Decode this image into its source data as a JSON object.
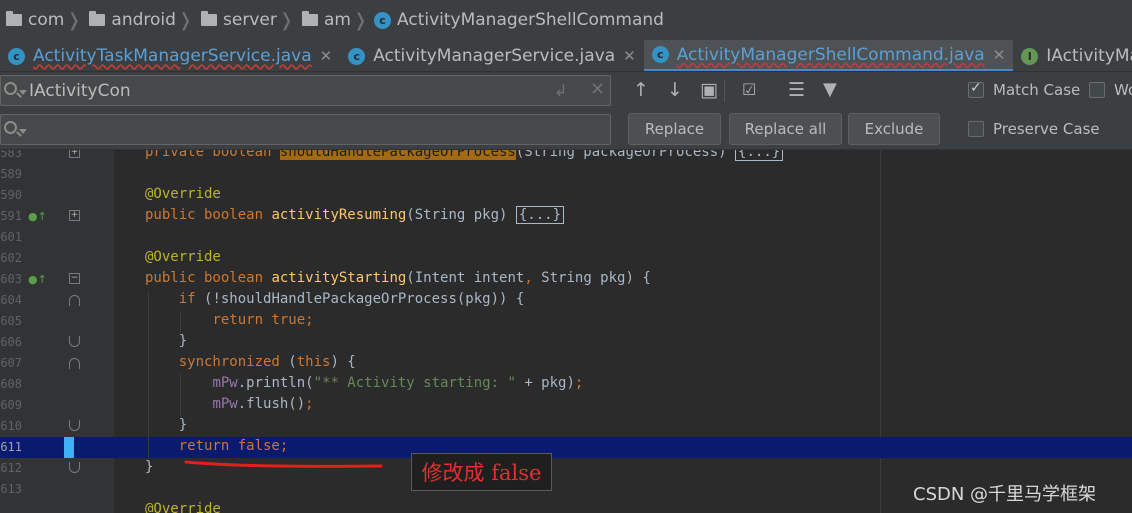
{
  "breadcrumb": {
    "items": [
      "com",
      "android",
      "server",
      "am",
      "ActivityManagerShellCommand"
    ]
  },
  "tabs": [
    {
      "label": "ActivityTaskManagerService.java",
      "icon": "class-icon",
      "has_error": true,
      "active": false
    },
    {
      "label": "ActivityManagerService.java",
      "icon": "class-icon",
      "has_error": false,
      "active": false
    },
    {
      "label": "ActivityManagerShellCommand.java",
      "icon": "class-icon",
      "has_error": true,
      "active": true
    },
    {
      "label": "IActivityManager",
      "icon": "interface-icon",
      "has_error": false,
      "active": false
    }
  ],
  "find": {
    "value": "IActivityCon",
    "replace_value": "",
    "replace_label": "Replace",
    "replace_all_label": "Replace all",
    "exclude_label": "Exclude",
    "match_case_label": "Match Case",
    "words_label": "Wo",
    "preserve_case_label": "Preserve Case",
    "match_case_checked": true,
    "words_checked": false,
    "preserve_case_checked": false
  },
  "editor": {
    "line_numbers": [
      "583",
      "589",
      "590",
      "591",
      "601",
      "602",
      "603",
      "604",
      "605",
      "606",
      "607",
      "608",
      "609",
      "610",
      "611",
      "612",
      "613"
    ],
    "highlighted_line": "611"
  },
  "annotation": {
    "text": "修改成 false",
    "color": "#e0312d"
  },
  "watermark": "CSDN @千里马学框架",
  "colors": {
    "keyword": "#cc7832",
    "method": "#ffc66d",
    "annotation": "#bbb529",
    "string": "#6a8759",
    "field": "#9876aa",
    "selection_line": "#0a1a6e",
    "search_match": "#a36a13"
  }
}
